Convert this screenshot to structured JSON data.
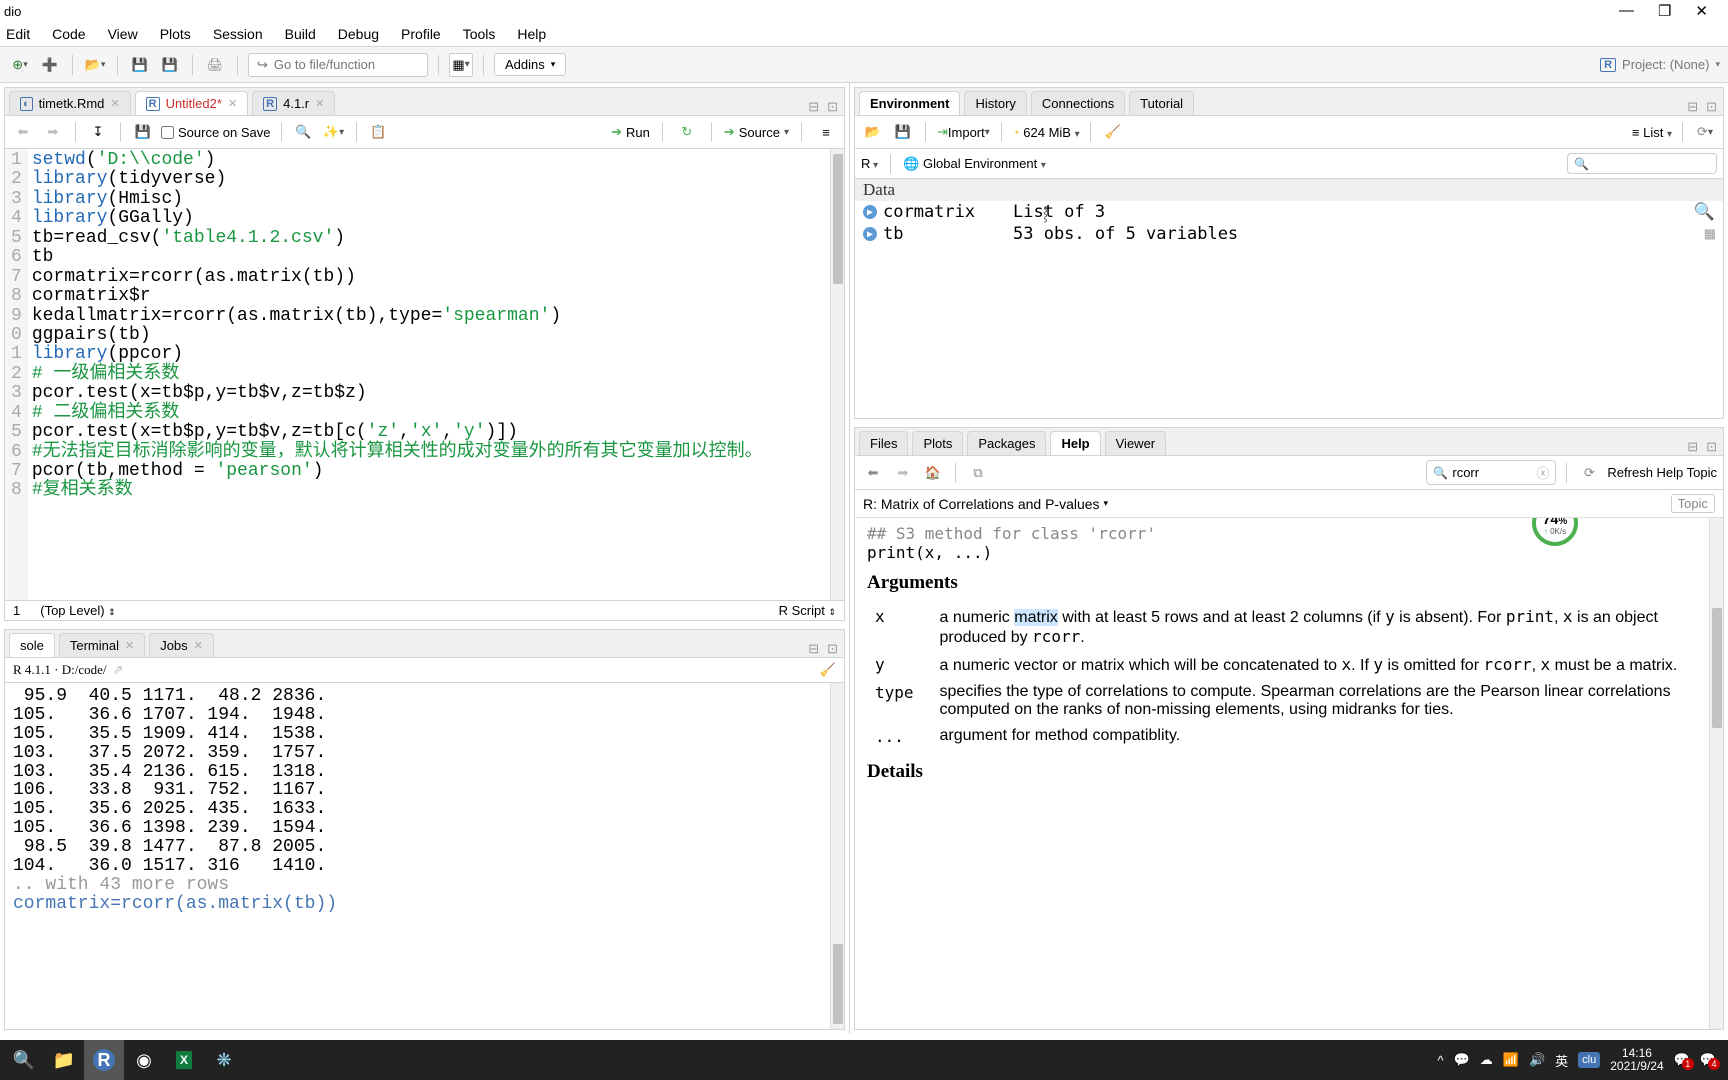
{
  "titlebar": {
    "title": "dio"
  },
  "menus": [
    "Edit",
    "Code",
    "View",
    "Plots",
    "Session",
    "Build",
    "Debug",
    "Profile",
    "Tools",
    "Help"
  ],
  "toolbar": {
    "goto_placeholder": "Go to file/function",
    "addins": "Addins",
    "project": "Project: (None)"
  },
  "source": {
    "tabs": [
      {
        "name": "timetk.Rmd",
        "type": "rmd",
        "dirty": false
      },
      {
        "name": "Untitled2*",
        "type": "r",
        "dirty": true
      },
      {
        "name": "4.1.r",
        "type": "r",
        "dirty": false
      }
    ],
    "source_on_save": "Source on Save",
    "run": "Run",
    "source_btn": "Source",
    "gutter": "1\n2\n3\n4\n5\n6\n7\n8\n9\n0\n1\n2\n3\n4\n5\n6\n7\n8",
    "status": {
      "line": "1",
      "scope": "(Top Level)",
      "type": "R Script"
    }
  },
  "code_lines": {
    "l1a": "setwd",
    "l1b": "(",
    "l1c": "'D:\\\\code'",
    "l1d": ")",
    "l2a": "library",
    "l2b": "(tidyverse)",
    "l3a": "library",
    "l3b": "(Hmisc)",
    "l4a": "library",
    "l4b": "(GGally)",
    "l5a": "tb=read_csv(",
    "l5b": "'table4.1.2.csv'",
    "l5c": ")",
    "l6": "tb",
    "l7": "cormatrix=rcorr(as.matrix(tb))",
    "l8": "cormatrix$r",
    "l9a": "kedallmatrix=rcorr(as.matrix(tb),type=",
    "l9b": "'spearman'",
    "l9c": ")",
    "l10": "ggpairs(tb)",
    "l11a": "library",
    "l11b": "(ppcor)",
    "l12": "# 一级偏相关系数",
    "l13": "pcor.test(x=tb$p,y=tb$v,z=tb$z)",
    "l14": "# 二级偏相关系数",
    "l15a": "pcor.test(x=tb$p,y=tb$v,z=tb[c(",
    "l15b": "'z'",
    "l15c": ",",
    "l15d": "'x'",
    "l15e": ",",
    "l15f": "'y'",
    "l15g": ")])",
    "l16": "#无法指定目标消除影响的变量，默认将计算相关性的成对变量外的所有其它变量加以控制。",
    "l17a": "pcor(tb,method = ",
    "l17b": "'pearson'",
    "l17c": ")",
    "l18": "#复相关系数"
  },
  "console": {
    "tabs": [
      "sole",
      "Terminal",
      "Jobs"
    ],
    "path": "R 4.1.1 · D:/code/",
    "lines": [
      " 95.9  40.5 1171.  48.2 2836.",
      "105.   36.6 1707. 194.  1948.",
      "105.   35.5 1909. 414.  1538.",
      "103.   37.5 2072. 359.  1757.",
      "103.   35.4 2136. 615.  1318.",
      "106.   33.8  931. 752.  1167.",
      "105.   35.6 2025. 435.  1633.",
      "105.   36.6 1398. 239.  1594.",
      " 98.5  39.8 1477.  87.8 2005.",
      "104.   36.0 1517. 316   1410."
    ],
    "more_rows": ".. with 43 more rows",
    "last_cmd": "cormatrix=rcorr(as.matrix(tb))"
  },
  "env": {
    "tabs": [
      "Environment",
      "History",
      "Connections",
      "Tutorial"
    ],
    "import": "Import",
    "mem": "624 MiB",
    "list": "List",
    "scope_lang": "R",
    "scope_env": "Global Environment",
    "cat": "Data",
    "rows": [
      {
        "name": "cormatrix",
        "val": "List of  3"
      },
      {
        "name": "tb",
        "val": "53 obs. of 5 variables"
      }
    ]
  },
  "help": {
    "tabs": [
      "Files",
      "Plots",
      "Packages",
      "Help",
      "Viewer"
    ],
    "search_value": "rcorr",
    "refresh": "Refresh Help Topic",
    "topic_title": "R: Matrix of Correlations and P-values",
    "find_topic": "Topic",
    "pre1": "## S3 method for class 'rcorr'",
    "pre2": "print(x, ...)",
    "arg_header": "Arguments",
    "details_header": "Details",
    "args": {
      "x": {
        "p1": "a numeric ",
        "matrix": "matrix",
        "p2": " with at least 5 rows and at least 2 columns (if ",
        "y": "y",
        "p3": " is absent). For ",
        "print": "print",
        "p4": ", ",
        "xx": "x",
        "p5": " is an object produced by ",
        "rcorr": "rcorr",
        "p6": "."
      },
      "y": {
        "p1": "a numeric vector or matrix which will be concatenated to ",
        "x": "x",
        "p2": ". If ",
        "y": "y",
        "p3": " is omitted for ",
        "rcorr": "rcorr",
        "p4": ", ",
        "xx": "x",
        "p5": " must be a matrix."
      },
      "type": "specifies the type of correlations to compute. Spearman correlations are the Pearson linear correlations computed on the ranks of non-missing elements, using midranks for ties.",
      "dots": "argument for method compatiblity."
    },
    "gauge": {
      "pct": "74",
      "pct_suffix": "%",
      "sub": "0K/s"
    }
  },
  "taskbar": {
    "systray": {
      "ime": "英",
      "time": "14:16",
      "date": "2021/9/24",
      "notif1": "1",
      "notif2": "4"
    }
  },
  "labels": {
    "arg_x": "x",
    "arg_y": "y",
    "arg_type": "type",
    "arg_dots": "..."
  }
}
